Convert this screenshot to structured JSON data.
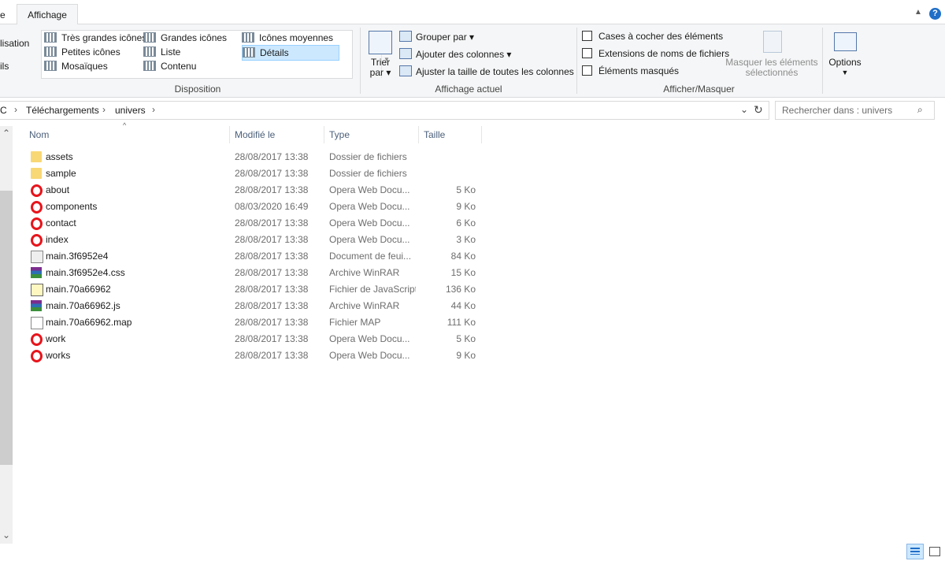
{
  "tabs": {
    "partial": "e",
    "active": "Affichage"
  },
  "ribbon": {
    "gallery": {
      "col1": [
        "Très grandes icônes",
        "Petites icônes",
        "Mosaïques"
      ],
      "col2": [
        "Grandes icônes",
        "Liste",
        "Contenu"
      ],
      "col3": [
        "Icônes moyennes",
        "Détails"
      ]
    },
    "left_partial": [
      "lisation",
      "ils"
    ],
    "group_labels": {
      "disposition": "Disposition",
      "affichage_actuel": "Affichage actuel",
      "afficher_masquer": "Afficher/Masquer"
    },
    "trier": [
      "Trier",
      "par"
    ],
    "grouper": "Grouper par",
    "ajouter_colonnes": "Ajouter des colonnes",
    "ajuster": "Ajuster la taille de toutes les colonnes",
    "checkboxes": [
      "Cases à cocher des éléments",
      "Extensions de noms de fichiers",
      "Éléments masqués"
    ],
    "masquer": [
      "Masquer les éléments",
      "sélectionnés"
    ],
    "options": "Options"
  },
  "address": {
    "crumbs": [
      "C",
      "Téléchargements",
      "univers"
    ]
  },
  "search": {
    "placeholder": "Rechercher dans : univers"
  },
  "columns": [
    "Nom",
    "Modifié le",
    "Type",
    "Taille"
  ],
  "files": [
    {
      "name": "assets",
      "date": "28/08/2017 13:38",
      "type": "Dossier de fichiers",
      "size": "",
      "icon": "folder"
    },
    {
      "name": "sample",
      "date": "28/08/2017 13:38",
      "type": "Dossier de fichiers",
      "size": "",
      "icon": "folder"
    },
    {
      "name": "about",
      "date": "28/08/2017 13:38",
      "type": "Opera Web Docu...",
      "size": "5 Ko",
      "icon": "opera"
    },
    {
      "name": "components",
      "date": "08/03/2020 16:49",
      "type": "Opera Web Docu...",
      "size": "9 Ko",
      "icon": "opera"
    },
    {
      "name": "contact",
      "date": "28/08/2017 13:38",
      "type": "Opera Web Docu...",
      "size": "6 Ko",
      "icon": "opera"
    },
    {
      "name": "index",
      "date": "28/08/2017 13:38",
      "type": "Opera Web Docu...",
      "size": "3 Ko",
      "icon": "opera"
    },
    {
      "name": "main.3f6952e4",
      "date": "28/08/2017 13:38",
      "type": "Document de feui...",
      "size": "84 Ko",
      "icon": "gear"
    },
    {
      "name": "main.3f6952e4.css",
      "date": "28/08/2017 13:38",
      "type": "Archive WinRAR",
      "size": "15 Ko",
      "icon": "winrar"
    },
    {
      "name": "main.70a66962",
      "date": "28/08/2017 13:38",
      "type": "Fichier de JavaScript",
      "size": "136 Ko",
      "icon": "jsfile"
    },
    {
      "name": "main.70a66962.js",
      "date": "28/08/2017 13:38",
      "type": "Archive WinRAR",
      "size": "44 Ko",
      "icon": "winrar"
    },
    {
      "name": "main.70a66962.map",
      "date": "28/08/2017 13:38",
      "type": "Fichier MAP",
      "size": "111 Ko",
      "icon": "doc"
    },
    {
      "name": "work",
      "date": "28/08/2017 13:38",
      "type": "Opera Web Docu...",
      "size": "5 Ko",
      "icon": "opera"
    },
    {
      "name": "works",
      "date": "28/08/2017 13:38",
      "type": "Opera Web Docu...",
      "size": "9 Ko",
      "icon": "opera"
    }
  ]
}
